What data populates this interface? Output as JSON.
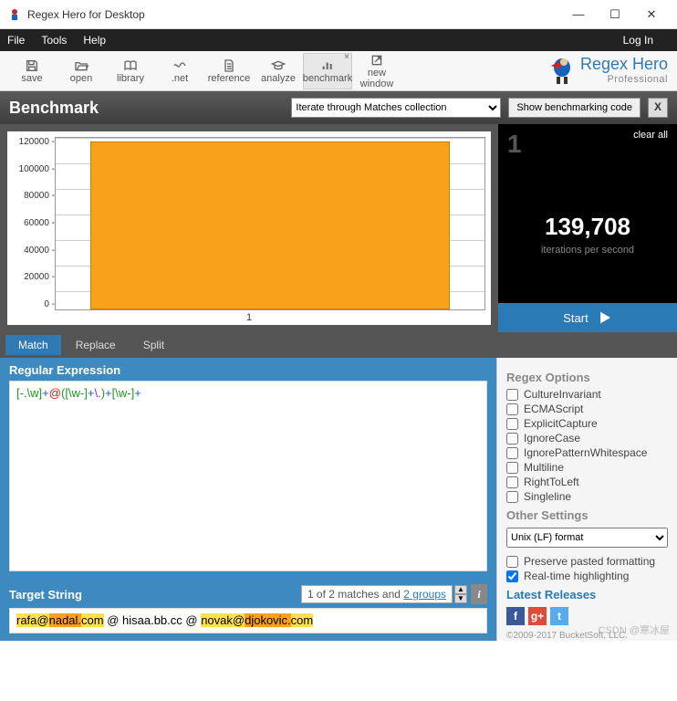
{
  "window": {
    "title": "Regex Hero for Desktop"
  },
  "menubar": {
    "file": "File",
    "tools": "Tools",
    "help": "Help",
    "login": "Log In"
  },
  "toolbar": {
    "save": "save",
    "open": "open",
    "library": "library",
    "net": ".net",
    "reference": "reference",
    "analyze": "analyze",
    "benchmark": "benchmark",
    "newwindow": "new window"
  },
  "brand": {
    "name": "Regex Hero",
    "edition": "Professional"
  },
  "benchmark": {
    "title": "Benchmark",
    "dropdown": "Iterate through Matches collection",
    "show_code": "Show benchmarking code",
    "result_index": "1",
    "clear": "clear all",
    "value": "139,708",
    "value_label": "iterations per second",
    "start": "Start"
  },
  "chart_data": {
    "type": "bar",
    "categories": [
      "1"
    ],
    "values": [
      139708
    ],
    "yticks": [
      "120000",
      "100000",
      "80000",
      "60000",
      "40000",
      "20000",
      "0"
    ],
    "ylim": [
      0,
      140000
    ],
    "title": "",
    "xlabel": "",
    "ylabel": ""
  },
  "tabs": {
    "match": "Match",
    "replace": "Replace",
    "split": "Split"
  },
  "regex": {
    "label": "Regular Expression",
    "tokens": [
      {
        "t": "[-.\\w]",
        "c": "green"
      },
      {
        "t": "+",
        "c": "blue"
      },
      {
        "t": "@",
        "c": "red"
      },
      {
        "t": "(",
        "c": "green"
      },
      {
        "t": "[\\w-]",
        "c": "green"
      },
      {
        "t": "+",
        "c": "blue"
      },
      {
        "t": "\\.",
        "c": "purple"
      },
      {
        "t": ")",
        "c": "green"
      },
      {
        "t": "+",
        "c": "blue"
      },
      {
        "t": "[\\w-]",
        "c": "green"
      },
      {
        "t": "+",
        "c": "blue"
      }
    ]
  },
  "target": {
    "label": "Target String",
    "match_info_pre": "1 of 2 matches and ",
    "match_info_link": "2 groups",
    "segments": [
      {
        "text": "rafa@",
        "cls": "hl"
      },
      {
        "text": "nadal.",
        "cls": "hl2"
      },
      {
        "text": "com",
        "cls": "hl"
      },
      {
        "text": " @ hisaa.bb.cc @ ",
        "cls": ""
      },
      {
        "text": "novak@",
        "cls": "hl"
      },
      {
        "text": "djokovic.",
        "cls": "hl2"
      },
      {
        "text": "com",
        "cls": "hl"
      }
    ]
  },
  "options": {
    "header": "Regex Options",
    "items": [
      "CultureInvariant",
      "ECMAScript",
      "ExplicitCapture",
      "IgnoreCase",
      "IgnorePatternWhitespace",
      "Multiline",
      "RightToLeft",
      "Singleline"
    ],
    "other_header": "Other Settings",
    "format": "Unix (LF) format",
    "preserve": "Preserve pasted formatting",
    "realtime": "Real-time highlighting",
    "releases_header": "Latest Releases",
    "copyright": "©2009-2017 BucketSoft, LLC."
  },
  "watermark": "CSDN @寒冰屋"
}
